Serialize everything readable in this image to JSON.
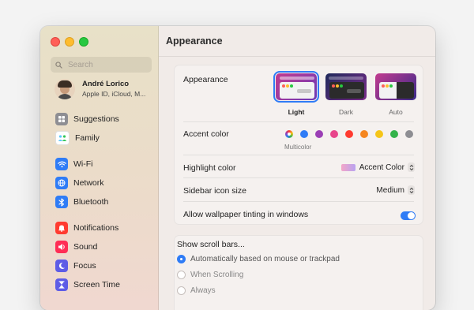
{
  "window": {
    "title": "Appearance"
  },
  "sidebar": {
    "search_placeholder": "Search",
    "account": {
      "name": "André Lorico",
      "subtitle": "Apple ID, iCloud, M..."
    },
    "items": [
      {
        "label": "Suggestions",
        "icon": "suggestions-icon",
        "color": "#8e8e93"
      },
      {
        "label": "Family",
        "icon": "family-icon",
        "color": "#5ac8fa"
      },
      {
        "label": "Wi-Fi",
        "icon": "wifi-icon",
        "color": "#2f7cf6"
      },
      {
        "label": "Network",
        "icon": "globe-icon",
        "color": "#2f7cf6"
      },
      {
        "label": "Bluetooth",
        "icon": "bluetooth-icon",
        "color": "#2f7cf6"
      },
      {
        "label": "Notifications",
        "icon": "bell-icon",
        "color": "#ff3b30"
      },
      {
        "label": "Sound",
        "icon": "speaker-icon",
        "color": "#ff2d55"
      },
      {
        "label": "Focus",
        "icon": "moon-icon",
        "color": "#5e5ce6"
      },
      {
        "label": "Screen Time",
        "icon": "hourglass-icon",
        "color": "#5e5ce6"
      }
    ]
  },
  "appearance": {
    "label": "Appearance",
    "options": [
      {
        "label": "Light",
        "selected": true
      },
      {
        "label": "Dark",
        "selected": false
      },
      {
        "label": "Auto",
        "selected": false
      }
    ]
  },
  "accent": {
    "label": "Accent color",
    "multicolor_label": "Multicolor",
    "colors": [
      "#2f7cf6",
      "#9b3fb5",
      "#e8458b",
      "#ff3b30",
      "#f5861f",
      "#f5c518",
      "#34b34a",
      "#8e8e93"
    ]
  },
  "highlight": {
    "label": "Highlight color",
    "value": "Accent Color"
  },
  "sidebar_icon_size": {
    "label": "Sidebar icon size",
    "value": "Medium"
  },
  "wallpaper_tinting": {
    "label": "Allow wallpaper tinting in windows",
    "enabled": true
  },
  "scroll_bars": {
    "label": "Show scroll bars...",
    "options": [
      {
        "label": "Automatically based on mouse or trackpad",
        "selected": true
      },
      {
        "label": "When Scrolling",
        "selected": false
      },
      {
        "label": "Always",
        "selected": false
      }
    ]
  }
}
